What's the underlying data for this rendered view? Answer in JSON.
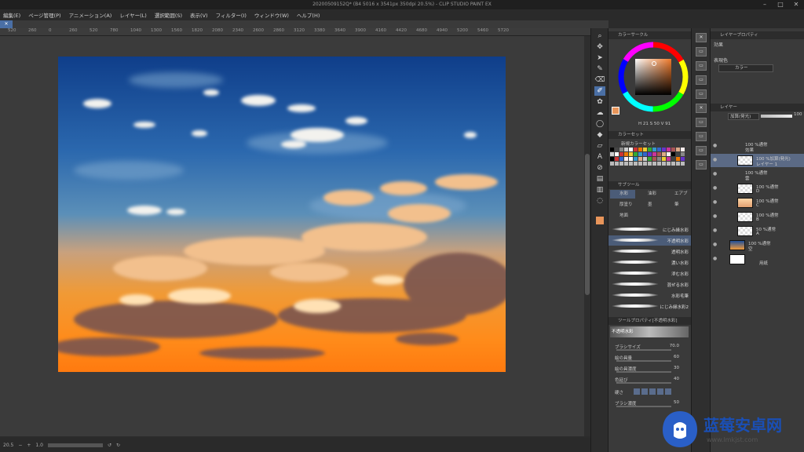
{
  "window": {
    "title": "20200509152Q* (B4 5016 x 3541px 350dpi 20.5%) - CLIP STUDIO PAINT EX"
  },
  "menu": [
    "編集(E)",
    "ページ管理(P)",
    "アニメーション(A)",
    "レイヤー(L)",
    "選択範囲(S)",
    "表示(V)",
    "フィルター(I)",
    "ウィンドウ(W)",
    "ヘルプ(H)"
  ],
  "ruler_ticks": [
    "520",
    "260",
    "0",
    "260",
    "520",
    "780",
    "1040",
    "1300",
    "1560",
    "1820",
    "2080",
    "2340",
    "2600",
    "2860",
    "3120",
    "3380",
    "3640",
    "3900",
    "4160",
    "4420",
    "4680",
    "4940",
    "5200",
    "5460",
    "5720"
  ],
  "status": {
    "zoom": "20.5",
    "rotation": "1.0"
  },
  "color_panel": {
    "header": "カラーサークル",
    "accent_color": "#e8955a",
    "hsv_readout": "H 21  S 50  V 91"
  },
  "color_set": {
    "header": "カラーセット",
    "name": "新規カラーセット"
  },
  "sub_tool": {
    "header": "サブツール",
    "tabs": [
      "水彩",
      "油彩",
      "エアブ",
      "厚塗り",
      "墨",
      "筆",
      "地面"
    ],
    "brushes": [
      "にじみ縁水彩",
      "不透明水彩",
      "透明水彩",
      "濃い水彩",
      "滲む水彩",
      "混ぜる水彩",
      "水彩毛筆",
      "にじみ縁水彩2"
    ],
    "selected_index": 1
  },
  "tool_property": {
    "header": "ツールプロパティ[不透明水彩]",
    "brush_name": "不透明水彩",
    "props": [
      {
        "k": "ブラシサイズ",
        "v": "70.0"
      },
      {
        "k": "絵の具量",
        "v": "60"
      },
      {
        "k": "絵の具濃度",
        "v": "30"
      },
      {
        "k": "色延び",
        "v": "40"
      },
      {
        "k": "硬さ",
        "v": ""
      },
      {
        "k": "ブラシ濃度",
        "v": "50"
      }
    ]
  },
  "effect_panel": {
    "header": "レイヤープロパティ",
    "effect_label": "効果",
    "display_color_label": "表現色",
    "display_color_value": "カラー"
  },
  "layers": {
    "header": "レイヤー",
    "blend_mode": "加算(発光)",
    "opacity": "100",
    "items": [
      {
        "l1": "100 %通常",
        "l2": "効果"
      },
      {
        "l1": "100 %加算(発光)",
        "l2": "レイヤー 1"
      },
      {
        "l1": "100 %通常",
        "l2": "雲"
      },
      {
        "l1": "100 %通常",
        "l2": "D"
      },
      {
        "l1": "100 %通常",
        "l2": "C"
      },
      {
        "l1": "100 %通常",
        "l2": "B"
      },
      {
        "l1": "50 %通常",
        "l2": "A"
      },
      {
        "l1": "100 %通常",
        "l2": "空"
      },
      {
        "l1": "",
        "l2": "用紙"
      }
    ],
    "selected_index": 1
  },
  "watermark": {
    "brand": "蓝莓安卓网",
    "url": "www.lmkjst.com"
  }
}
